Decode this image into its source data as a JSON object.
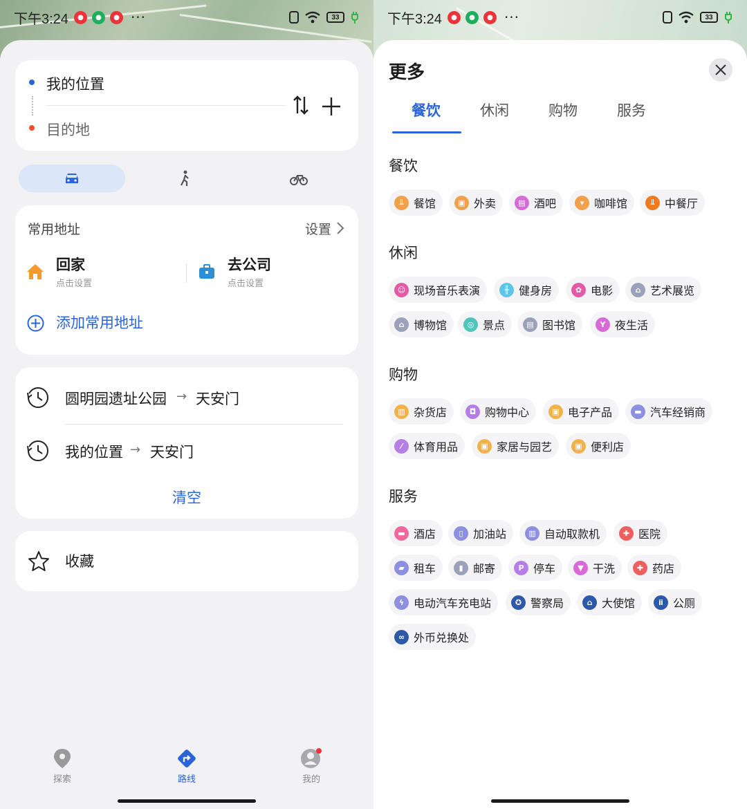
{
  "status": {
    "time": "下午3:24",
    "battery": "33"
  },
  "route": {
    "from": "我的位置",
    "to": "目的地"
  },
  "common": {
    "title": "常用地址",
    "settings": "设置",
    "home": {
      "label": "回家",
      "sub": "点击设置"
    },
    "work": {
      "label": "去公司",
      "sub": "点击设置"
    },
    "add": "添加常用地址"
  },
  "recent": {
    "items": [
      {
        "from": "圆明园遗址公园",
        "to": "天安门"
      },
      {
        "from": "我的位置",
        "to": "天安门"
      }
    ],
    "arrow": "→",
    "clear": "清空"
  },
  "favorites": {
    "label": "收藏"
  },
  "nav": {
    "explore": "探索",
    "route": "路线",
    "me": "我的"
  },
  "more": {
    "title": "更多",
    "tabs": [
      "餐饮",
      "休闲",
      "购物",
      "服务"
    ],
    "sections": [
      {
        "title": "餐饮",
        "items": [
          "餐馆",
          "外卖",
          "酒吧",
          "咖啡馆",
          "中餐厅"
        ]
      },
      {
        "title": "休闲",
        "items": [
          "现场音乐表演",
          "健身房",
          "电影",
          "艺术展览",
          "博物馆",
          "景点",
          "图书馆",
          "夜生活"
        ]
      },
      {
        "title": "购物",
        "items": [
          "杂货店",
          "购物中心",
          "电子产品",
          "汽车经销商",
          "体育用品",
          "家居与园艺",
          "便利店"
        ]
      },
      {
        "title": "服务",
        "items": [
          "酒店",
          "加油站",
          "自动取款机",
          "医院",
          "租车",
          "邮寄",
          "停车",
          "干洗",
          "药店",
          "电动汽车充电站",
          "警察局",
          "大使馆",
          "公厕",
          "外币兑换处"
        ]
      }
    ]
  },
  "colors": {
    "accent": "#2b64d6",
    "home_icon": "#f59a2b",
    "work_icon": "#2b8fd6",
    "notification": "#e8343a"
  }
}
